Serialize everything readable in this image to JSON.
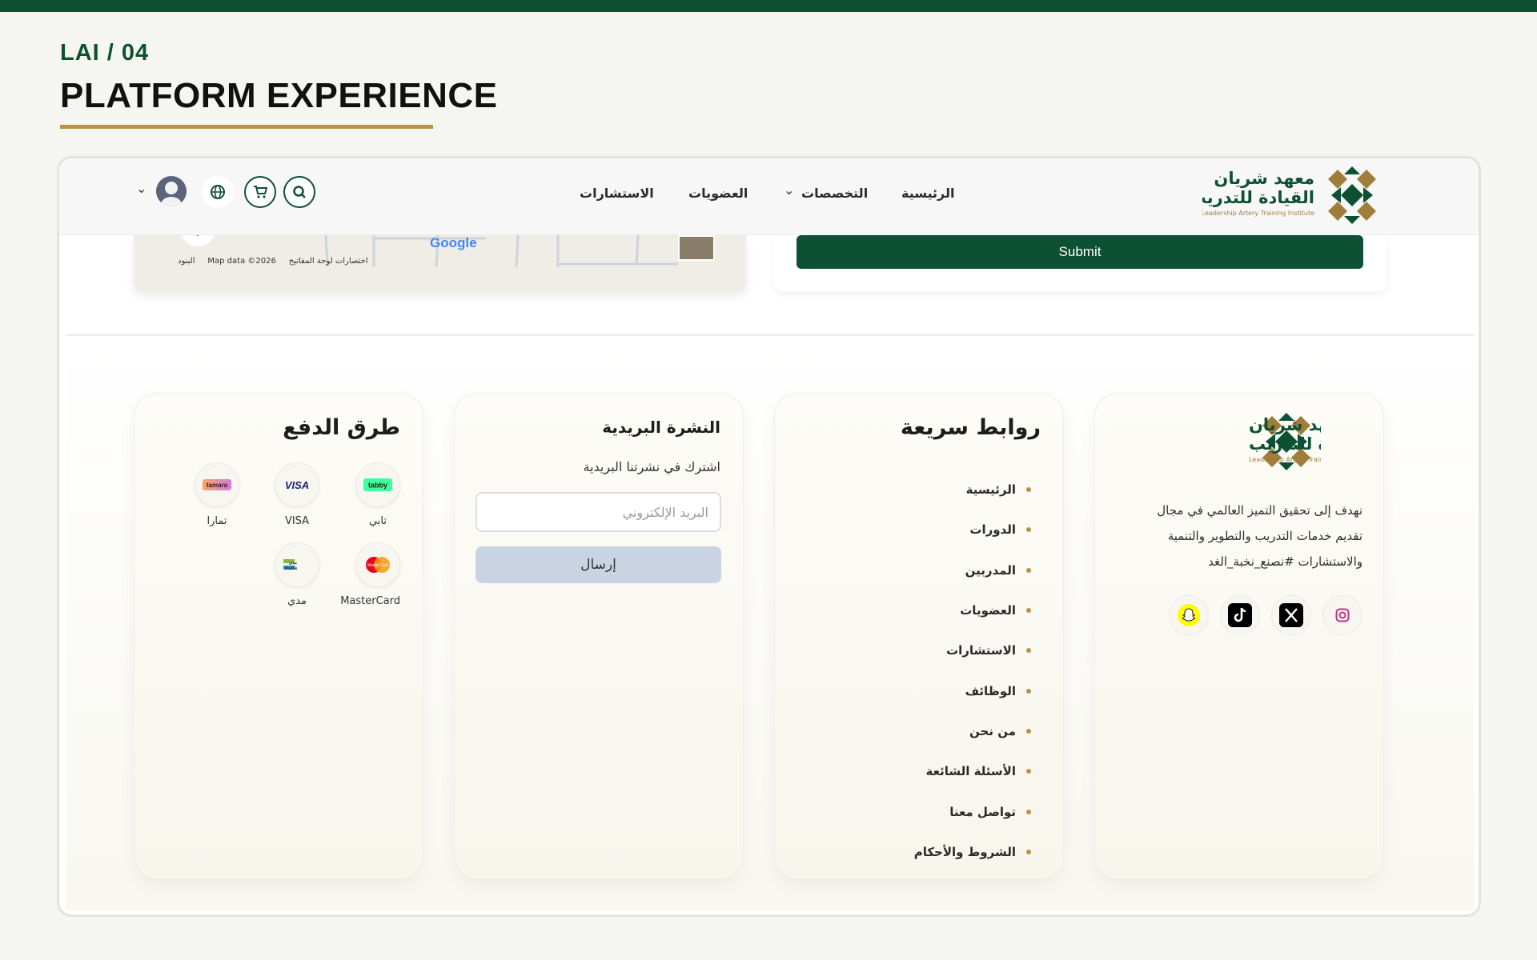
{
  "slide": {
    "label": "LAI  /  04",
    "title": "PLATFORM EXPERIENCE"
  },
  "colors": {
    "brand_green": "#0e5033",
    "accent_gold": "#b8924a"
  },
  "navbar": {
    "logo_text_line1": "معهد شريان",
    "logo_text_line2": "القيادة للتدريب",
    "logo_text_en": "Leadership Artery Training Institute",
    "links": [
      {
        "label": "الرئيسية"
      },
      {
        "label": "التخصصات",
        "has_dropdown": true
      },
      {
        "label": "العضويات"
      },
      {
        "label": "الاستشارات"
      }
    ],
    "icons": [
      "search-icon",
      "cart-icon",
      "globe-icon",
      "user-avatar",
      "chevron-down-icon"
    ]
  },
  "contact": {
    "map": {
      "provider": "Google",
      "attribution_data": "Map data ©2026",
      "attribution_shortcuts": "اختصارات لوحة المفاتيح",
      "attribution_terms": "البنود"
    },
    "submit_label": "Submit"
  },
  "footer": {
    "about": {
      "logo_text_line1": "معهد شريان",
      "logo_text_line2": "القيادة للتدريب",
      "logo_text_en": "Leadership Artery Training Institute",
      "description": "نهدف إلى تحقيق التميز العالمي في مجال تقديم خدمات التدريب والتطوير والتنمية والاستشارات #نصنع_نخبة_الغد",
      "social": [
        "instagram-icon",
        "x-icon",
        "tiktok-icon",
        "snapchat-icon"
      ]
    },
    "quick_links": {
      "heading": "روابط سريعة",
      "items": [
        "الرئيسية",
        "الدورات",
        "المدربين",
        "العضويات",
        "الاستشارات",
        "الوظائف",
        "من نحن",
        "الأسئلة الشائعة",
        "تواصل معنا",
        "الشروط والأحكام"
      ]
    },
    "newsletter": {
      "heading": "النشرة البريدية",
      "subtitle": "اشترك في نشرتنا البريدية",
      "email_placeholder": "البريد الإلكتروني",
      "send_label": "إرسال"
    },
    "payment": {
      "heading": "طرق الدفع",
      "methods": [
        {
          "name": "تابي",
          "badge": "tabby"
        },
        {
          "name": "VISA",
          "badge": "VISA"
        },
        {
          "name": "تمارا",
          "badge": "tamara"
        },
        {
          "name": "MasterCard",
          "badge": "MasterCard"
        },
        {
          "name": "مدي",
          "badge": "mada"
        }
      ]
    }
  }
}
